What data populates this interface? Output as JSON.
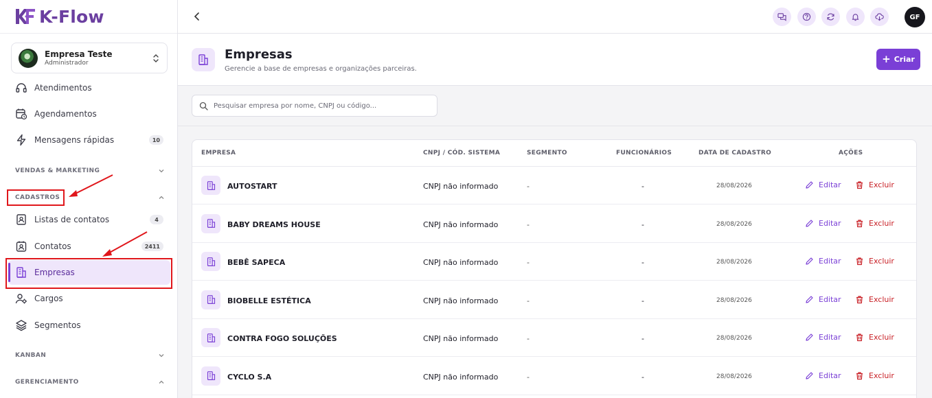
{
  "app": {
    "brand": "K-Flow",
    "brand_color": "#6b3fa0",
    "accent": "#7a3fd6",
    "highlight": "#e0161b"
  },
  "company": {
    "name": "Empresa Teste",
    "role": "Administrador"
  },
  "nav_top": [
    {
      "label": "Atendimentos",
      "icon": "headset-icon"
    },
    {
      "label": "Agendamentos",
      "icon": "calendar-clock-icon"
    },
    {
      "label": "Mensagens rápidas",
      "icon": "lightning-icon",
      "badge": "10"
    }
  ],
  "sections": {
    "vendas": "VENDAS & MARKETING",
    "cadastros": "CADASTROS",
    "kanban": "KANBAN",
    "gerenciamento": "GERENCIAMENTO"
  },
  "nav_cadastros": [
    {
      "label": "Listas de contatos",
      "icon": "contact-book-icon",
      "badge": "4"
    },
    {
      "label": "Contatos",
      "icon": "contact-card-icon",
      "badge": "2411"
    },
    {
      "label": "Empresas",
      "icon": "building-icon",
      "active": true
    },
    {
      "label": "Cargos",
      "icon": "user-gear-icon"
    },
    {
      "label": "Segmentos",
      "icon": "layers-icon"
    }
  ],
  "topbar_icons": [
    "chat-icon",
    "help-icon",
    "refresh-icon",
    "bell-icon",
    "cloud-download-icon"
  ],
  "user": {
    "initials": "GF"
  },
  "page": {
    "title": "Empresas",
    "subtitle": "Gerencie a base de empresas e organizações parceiras.",
    "create_label": "Criar"
  },
  "search": {
    "placeholder": "Pesquisar empresa por nome, CNPJ ou código..."
  },
  "table": {
    "headers": {
      "empresa": "EMPRESA",
      "cnpj": "CNPJ / CÓD. SISTEMA",
      "segmento": "SEGMENTO",
      "funcionarios": "FUNCIONÁRIOS",
      "data": "DATA DE CADASTRO",
      "acoes": "AÇÕES"
    },
    "edit_label": "Editar",
    "delete_label": "Excluir",
    "rows": [
      {
        "name": "AUTOSTART",
        "cnpj": "CNPJ não informado",
        "segment": "-",
        "employees": "-",
        "date": "28/08/2026"
      },
      {
        "name": "BABY DREAMS HOUSE",
        "cnpj": "CNPJ não informado",
        "segment": "-",
        "employees": "-",
        "date": "28/08/2026"
      },
      {
        "name": "BEBÊ SAPECA",
        "cnpj": "CNPJ não informado",
        "segment": "-",
        "employees": "-",
        "date": "28/08/2026"
      },
      {
        "name": "BIOBELLE ESTÉTICA",
        "cnpj": "CNPJ não informado",
        "segment": "-",
        "employees": "-",
        "date": "28/08/2026"
      },
      {
        "name": "CONTRA FOGO SOLUÇÕES",
        "cnpj": "CNPJ não informado",
        "segment": "-",
        "employees": "-",
        "date": "28/08/2026"
      },
      {
        "name": "CYCLO S.A",
        "cnpj": "CNPJ não informado",
        "segment": "-",
        "employees": "-",
        "date": "28/08/2026"
      }
    ]
  }
}
